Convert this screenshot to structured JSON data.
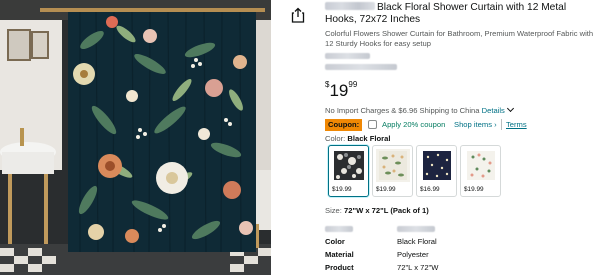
{
  "product": {
    "title": "Black Floral Shower Curtain with 12 Metal Hooks, 72x72 Inches",
    "subtitle": "Colorful Flowers Shower Curtain for Bathroom, Premium Waterproof Fabric with 12 Sturdy Hooks for easy setup"
  },
  "price": {
    "symbol": "$",
    "whole": "19",
    "fraction": "99"
  },
  "shipping": {
    "text": "No Import Charges & $6.96 Shipping to China",
    "details_link": "Details"
  },
  "coupon": {
    "badge": "Coupon:",
    "apply_label": "Apply 20% coupon",
    "shop_items": "Shop items ›",
    "terms": "Terms"
  },
  "color": {
    "label": "Color:",
    "selected": "Black Floral",
    "options": [
      {
        "price": "$19.99",
        "selected": true
      },
      {
        "price": "$19.99",
        "selected": false
      },
      {
        "price": "$16.99",
        "selected": false
      },
      {
        "price": "$19.99",
        "selected": false
      }
    ]
  },
  "size": {
    "label": "Size:",
    "value": "72\"W x 72\"L (Pack of 1)"
  },
  "specs": [
    {
      "key": "Color",
      "value": "Black Floral"
    },
    {
      "key": "Material",
      "value": "Polyester"
    },
    {
      "key": "Product",
      "value": "72\"L x 72\"W"
    }
  ],
  "icons": {
    "share": "share-icon"
  },
  "colors": {
    "link": "#007185",
    "coupon_badge": "#f08804",
    "coupon_text": "#067d62",
    "text_primary": "#0f1111",
    "text_secondary": "#565959"
  }
}
